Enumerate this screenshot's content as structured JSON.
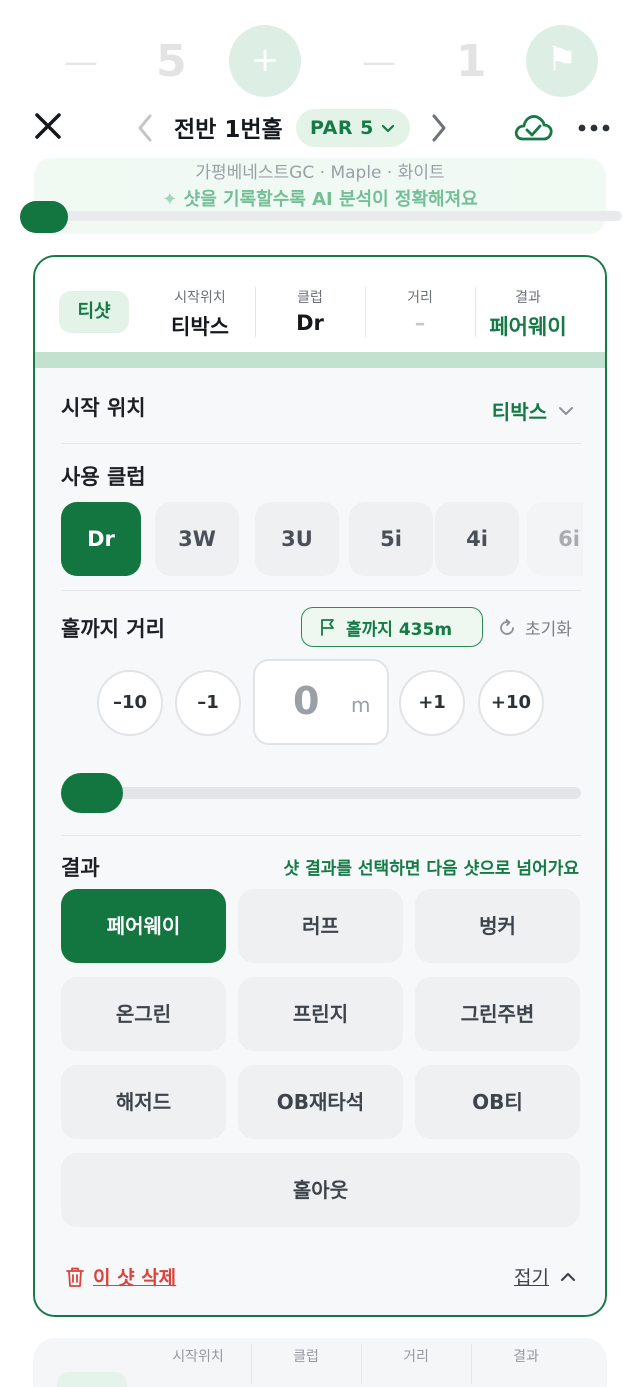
{
  "background_stepper": {
    "left_value": "5",
    "right_value": "1"
  },
  "header": {
    "hole_title": "전반 1번홀",
    "par_label": "PAR 5"
  },
  "banner": {
    "course_info": "가평베네스트GC · Maple · 화이트",
    "ai_hint": "샷을 기록할수록 AI 분석이 정확해져요"
  },
  "shot_summary": {
    "shot_type": "티샷",
    "start_label": "시작위치",
    "start_value": "티박스",
    "club_label": "클럽",
    "club_value": "Dr",
    "distance_label": "거리",
    "distance_value": "–",
    "result_label": "결과",
    "result_value": "페어웨이"
  },
  "start_position": {
    "title": "시작 위치",
    "value": "티박스"
  },
  "club_section": {
    "title": "사용 클럽",
    "clubs": [
      "Dr",
      "3W",
      "3U",
      "5i",
      "4i",
      "6i"
    ],
    "selected": "Dr"
  },
  "distance_section": {
    "title": "홀까지 거리",
    "to_hole": "홀까지 435m",
    "reset": "초기화",
    "steps": [
      "–10",
      "–1",
      "+1",
      "+10"
    ],
    "value": "0",
    "unit": "m",
    "slider_level": 0
  },
  "result_section": {
    "title": "결과",
    "hint": "샷 결과를 선택하면 다음 샷으로 넘어가요",
    "options": [
      "페어웨이",
      "러프",
      "벙커",
      "온그린",
      "프린지",
      "그린주변",
      "해저드",
      "OB재타석",
      "OB티",
      "홀아웃"
    ],
    "selected": "페어웨이"
  },
  "footer": {
    "delete": "이 샷 삭제",
    "collapse": "접기"
  },
  "next_card": {
    "labels": [
      "시작위치",
      "클럽",
      "거리",
      "결과"
    ]
  },
  "colors": {
    "brand_green": "#157a45",
    "danger_red": "#d9433c"
  }
}
